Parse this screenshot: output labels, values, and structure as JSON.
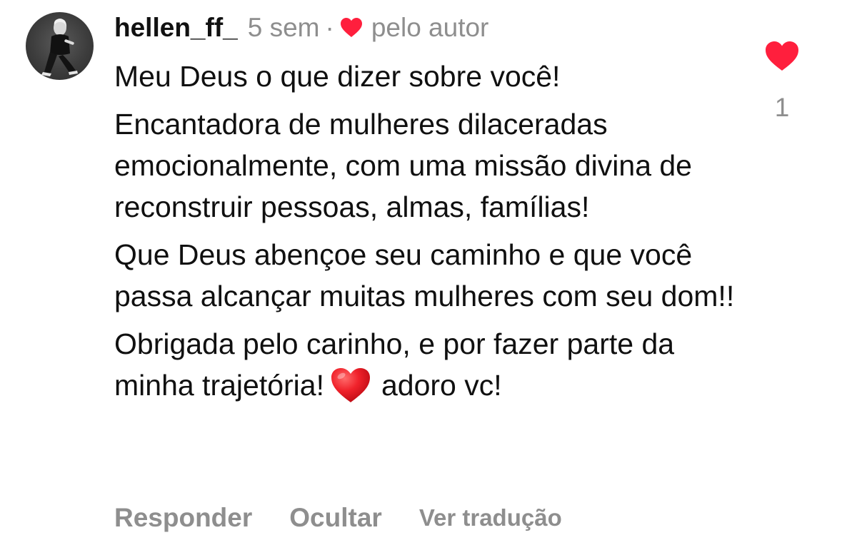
{
  "comment": {
    "username": "hellen_ff_",
    "time": "5 sem",
    "separator": "·",
    "liked_by_author_label": "pelo autor",
    "paragraphs": [
      "Meu Deus o que dizer sobre você!",
      "Encantadora de mulheres dilaceradas emocionalmente, com uma missão divina de reconstruir pessoas, almas, famílias!",
      "Que Deus abençoe seu caminho e que você passa alcançar muitas mulheres com seu dom!!"
    ],
    "last_paragraph": {
      "before_emoji": "Obrigada pelo carinho, e por fazer parte da minha trajetória!",
      "emoji": "red-heart-emoji",
      "after_emoji": "adoro vc!"
    },
    "like_count": "1",
    "actions": {
      "reply": "Responder",
      "hide": "Ocultar",
      "translate": "Ver tradução"
    }
  },
  "colors": {
    "heart_red": "#ff1f3d",
    "meta_gray": "#8e8e8e",
    "text": "#101010"
  }
}
